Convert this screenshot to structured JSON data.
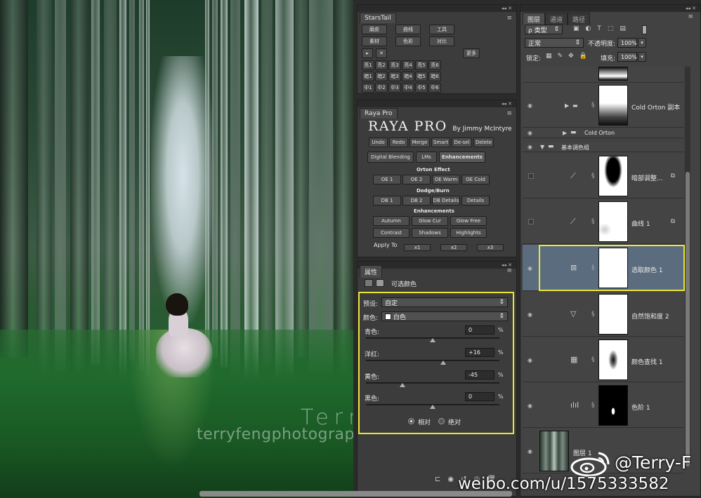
{
  "canvas": {
    "watermark_name": "Terry F",
    "watermark_site": "terryfengphotography.lofter.com"
  },
  "starstail": {
    "title": "StarsTail",
    "row1": [
      "磨皮",
      "曲线",
      "工具"
    ],
    "row2": [
      "素材",
      "色彩",
      "对比"
    ],
    "row3": [
      "▸",
      "✕",
      "更多"
    ],
    "row4": [
      "亮1",
      "亮2",
      "亮3",
      "亮4",
      "亮5",
      "亮6"
    ],
    "row5": [
      "暗1",
      "暗2",
      "暗3",
      "暗4",
      "暗5",
      "暗6"
    ],
    "row6": [
      "中1",
      "中2",
      "中3",
      "中4",
      "中5",
      "中6"
    ]
  },
  "raya": {
    "title": "Raya Pro",
    "logo": "RAYA PRO",
    "by": "By Jimmy McIntyre",
    "toolbar": [
      "Undo",
      "Redo",
      "Merge",
      "Smart",
      "De-sel",
      "Delete"
    ],
    "tabs": [
      "Digital Blending",
      "LMs",
      "Enhancements"
    ],
    "orton_title": "Orton Effect",
    "orton": [
      "OE 1",
      "OE 2",
      "OE Warm",
      "OE Cold"
    ],
    "dodge_title": "Dodge/Burn",
    "dodge": [
      "DB 1",
      "DB 2",
      "DB Details",
      "Details"
    ],
    "enh_title": "Enhancements",
    "enh1": [
      "Autumn",
      "Glow Cur",
      "Glow Free"
    ],
    "enh2": [
      "Contrast",
      "Shadows",
      "Highlights"
    ],
    "apply_label": "Apply To",
    "apply": [
      "x1",
      "x2",
      "x3"
    ]
  },
  "properties": {
    "tab": "属性",
    "header": "可选颜色",
    "preset_label": "预设:",
    "preset_value": "自定",
    "color_label": "颜色:",
    "color_value": "白色",
    "sliders": [
      {
        "label": "青色:",
        "value": "0",
        "level": 0
      },
      {
        "label": "洋红:",
        "value": "+16",
        "level": 16
      },
      {
        "label": "黄色:",
        "value": "-45",
        "level": -45
      },
      {
        "label": "黑色:",
        "value": "0",
        "level": 0
      }
    ],
    "percent": "%",
    "radio_relative": "相对",
    "radio_absolute": "绝对"
  },
  "layers": {
    "tabs": [
      "图层",
      "通道",
      "路径"
    ],
    "filter_label": "ρ 类型",
    "blend_mode": "正常",
    "opacity_label": "不透明度:",
    "opacity_value": "100%",
    "lock_label": "锁定:",
    "fill_label": "填充:",
    "fill_value": "100%",
    "items": [
      {
        "name": "Cold Orton 副本",
        "type": "group-layer"
      },
      {
        "name": "Cold Orton",
        "type": "folder"
      },
      {
        "name": "基本调色组",
        "type": "folder-open"
      },
      {
        "name": "暗部调整...",
        "type": "curves"
      },
      {
        "name": "曲线 1",
        "type": "curves"
      },
      {
        "name": "选取颜色 1",
        "type": "selective"
      },
      {
        "name": "自然饱和度 2",
        "type": "vibrance"
      },
      {
        "name": "颜色查找 1",
        "type": "lookup"
      },
      {
        "name": "色阶 1",
        "type": "levels"
      },
      {
        "name": "图层 1",
        "type": "image"
      }
    ]
  },
  "weibo": {
    "handle": "@Terry-F",
    "url": "weibo.com/u/1575333582"
  },
  "colors": {
    "highlight": "#e9e636",
    "selected_layer": "#5b6c7f"
  }
}
